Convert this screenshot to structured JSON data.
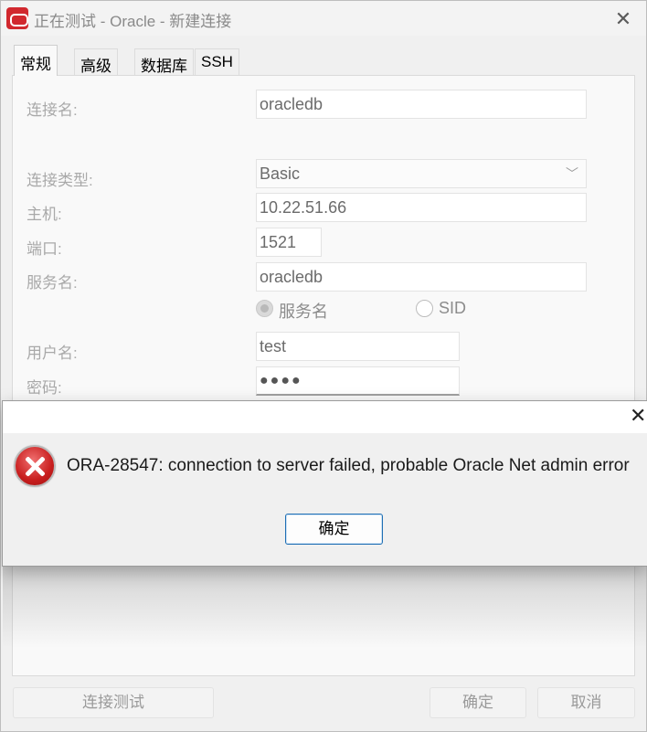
{
  "window": {
    "title": "正在测试 - Oracle - 新建连接"
  },
  "tabs": [
    {
      "label": "常规"
    },
    {
      "label": "高级"
    },
    {
      "label": "数据库"
    },
    {
      "label": "SSH"
    }
  ],
  "form": {
    "connection_name_label": "连接名:",
    "connection_name_value": "oracledb",
    "connection_type_label": "连接类型:",
    "connection_type_value": "Basic",
    "host_label": "主机:",
    "host_value": "10.22.51.66",
    "port_label": "端口:",
    "port_value": "1521",
    "service_name_label": "服务名:",
    "service_name_value": "oracledb",
    "radio_service_name": "服务名",
    "radio_sid": "SID",
    "selected_radio": "服务名",
    "username_label": "用户名:",
    "username_value": "test",
    "password_label": "密码:",
    "password_value": "●●●●"
  },
  "footer": {
    "test_connection": "连接测试",
    "ok": "确定",
    "cancel": "取消"
  },
  "error_dialog": {
    "message": "ORA-28547: connection to server failed, probable Oracle Net admin error",
    "ok_label": "确定"
  },
  "colors": {
    "brand": "#d1282e",
    "error_icon": "#c81e1e",
    "focus_border": "#1f6fb4"
  }
}
